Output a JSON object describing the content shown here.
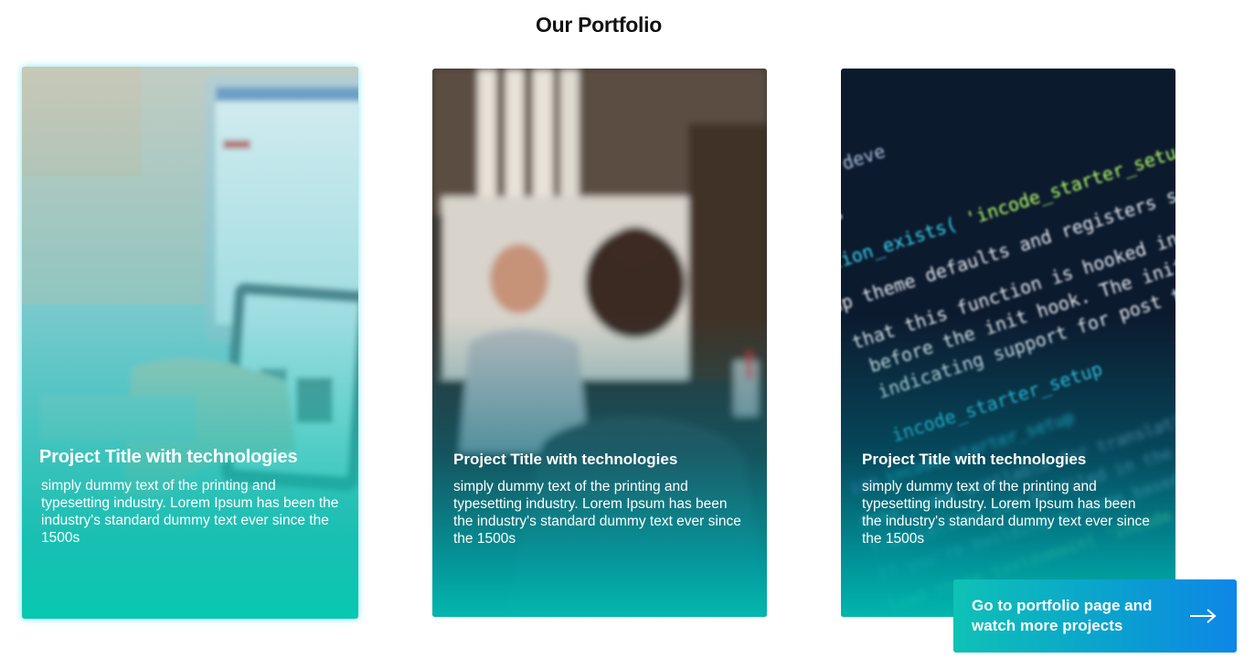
{
  "section": {
    "title": "Our Portfolio"
  },
  "cards": [
    {
      "title": "Project Title with technologies",
      "description": "simply dummy text of the printing and typesetting industry. Lorem Ipsum has been the industry's standard dummy text ever since the 1500s",
      "image": "laptop-tablet-photo"
    },
    {
      "title": "Project Title with technologies",
      "description": "simply dummy text of the printing and typesetting industry. Lorem Ipsum has been the industry's standard dummy text ever since the 1500s",
      "image": "meeting-people-photo"
    },
    {
      "title": "Project Title with technologies",
      "description": "simply dummy text of the printing and typesetting industry. Lorem Ipsum has been the industry's standard dummy text ever since the 1500s",
      "image": "code-screen-photo"
    }
  ],
  "cta": {
    "label": "Go to portfolio page and watch more projects",
    "icon": "arrow-right-icon"
  },
  "colors": {
    "accent_start": "#0ec2b5",
    "accent_end": "#0e86e8",
    "heading": "#111111"
  }
}
